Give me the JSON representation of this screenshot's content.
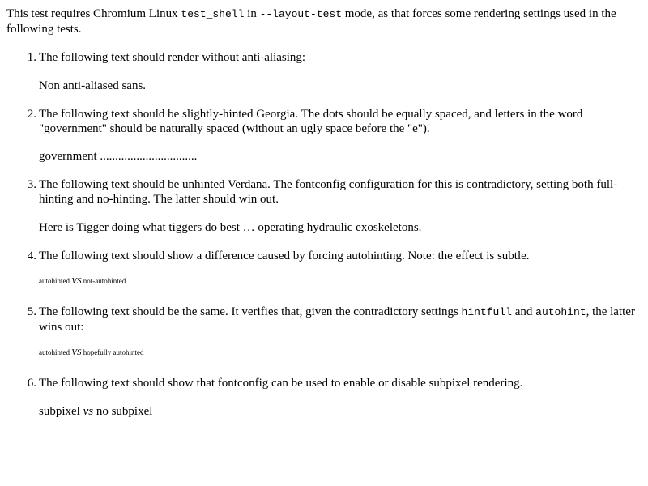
{
  "intro": {
    "before_code1": "This test requires Chromium Linux ",
    "code1": "test_shell",
    "between": " in ",
    "code2": "--layout-test",
    "after": " mode, as that forces some rendering settings used in the following tests."
  },
  "items": [
    {
      "number": "1.",
      "description": "The following text should render without anti-aliasing:",
      "sample": "Non anti-aliased sans."
    },
    {
      "number": "2.",
      "description": "The following text should be slightly-hinted Georgia. The dots should be equally spaced, and letters in the word \"government\" should be naturally spaced (without an ugly space before the \"e\").",
      "sample": "government ................................"
    },
    {
      "number": "3.",
      "description": "The following text should be unhinted Verdana. The fontconfig configuration for this is contradictory, setting both full-hinting and no-hinting. The latter should win out.",
      "sample": "Here is Tigger doing what tiggers do best … operating hydraulic exoskeletons."
    },
    {
      "number": "4.",
      "description": "The following text should show a difference caused by forcing autohinting. Note: the effect is subtle.",
      "sample_a": "autohinted",
      "sample_vs": "VS",
      "sample_b": "not-autohinted"
    },
    {
      "number": "5.",
      "desc_before": "The following text should be the same. It verifies that, given the contradictory settings ",
      "code1": "hintfull",
      "desc_mid": " and ",
      "code2": "autohint",
      "desc_after": ", the latter wins out:",
      "sample_a": "autohinted",
      "sample_vs": "VS",
      "sample_b": "hopefully autohinted"
    },
    {
      "number": "6.",
      "description": "The following text should show that fontconfig can be used to enable or disable subpixel rendering.",
      "sample_a": "subpixel",
      "sample_vs": "vs",
      "sample_b": "no subpixel"
    }
  ]
}
